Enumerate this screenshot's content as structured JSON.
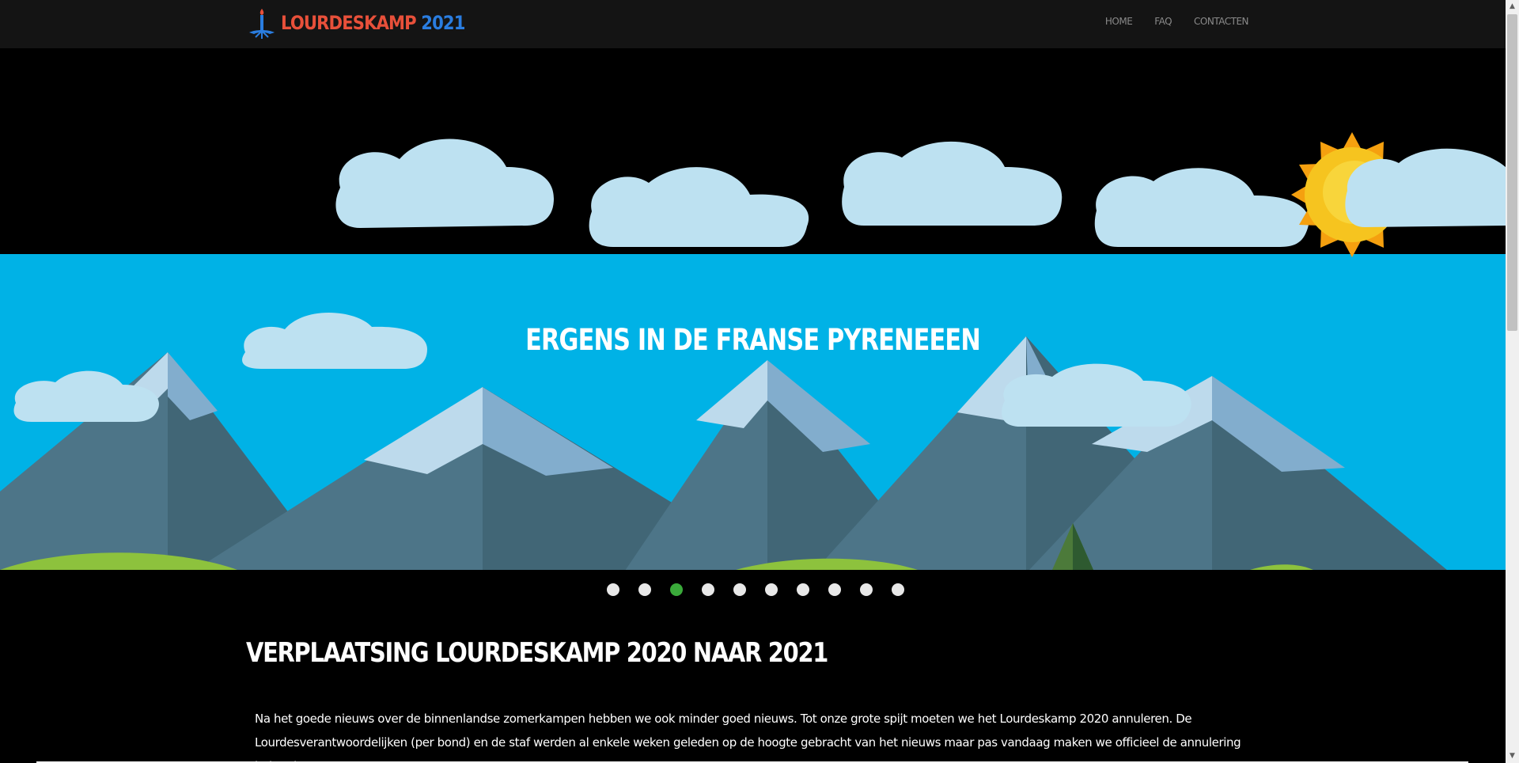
{
  "header": {
    "logo_word_1": "LOURDESKAMP",
    "logo_word_2": "2021",
    "nav": [
      {
        "label": "HOME"
      },
      {
        "label": "FAQ"
      },
      {
        "label": "CONTACTEN"
      }
    ]
  },
  "slider": {
    "caption": "ERGENS IN DE FRANSE PYRENEEEN",
    "slide_count": 10,
    "active_index": 2
  },
  "article": {
    "title": "VERPLAATSING LOURDESKAMP 2020 NAAR 2021",
    "body": "Na het goede nieuws over de binnenlandse zomerkampen hebben we ook minder goed nieuws. Tot onze grote spijt moeten we het Lourdeskamp 2020 annuleren. De Lourdesverantwoordelijken (per bond) en de staf werden al enkele weken geleden op de hoogte gebracht van het nieuws maar pas vandaag maken we officieel de annulering bekend."
  },
  "colors": {
    "header_bg": "#141414",
    "logo_red": "#e8503a",
    "logo_blue": "#2a7de0",
    "sky": "#00b2e6",
    "dot_active": "#3aaa3a",
    "dot_inactive": "#e8e8e8"
  },
  "icons": {
    "logo": "candle-icon",
    "scroll_up": "chevron-up-icon",
    "scroll_down": "chevron-down-icon"
  }
}
